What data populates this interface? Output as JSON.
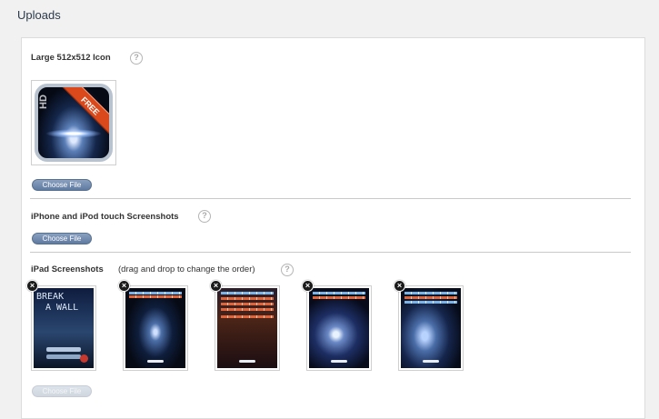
{
  "page": {
    "title": "Uploads"
  },
  "large_icon": {
    "label": "Large 512x512 Icon",
    "help": "?",
    "button": "Choose File",
    "image": {
      "ribbon_text": "FREE",
      "corner_text": "HD"
    }
  },
  "iphone": {
    "label": "iPhone and iPod touch Screenshots",
    "help": "?",
    "button": "Choose File"
  },
  "ipad": {
    "label": "iPad Screenshots",
    "hint": "(drag and drop to change the order)",
    "help": "?",
    "remove_glyph": "×",
    "button": "Choose File",
    "screenshots": [
      {
        "text_line1": "BREAK",
        "text_line2": "A WALL"
      },
      {},
      {},
      {},
      {}
    ]
  },
  "colors": {
    "button": "#5f7aa1",
    "title": "#2c3a4c",
    "ribbon": "#d9491b"
  }
}
